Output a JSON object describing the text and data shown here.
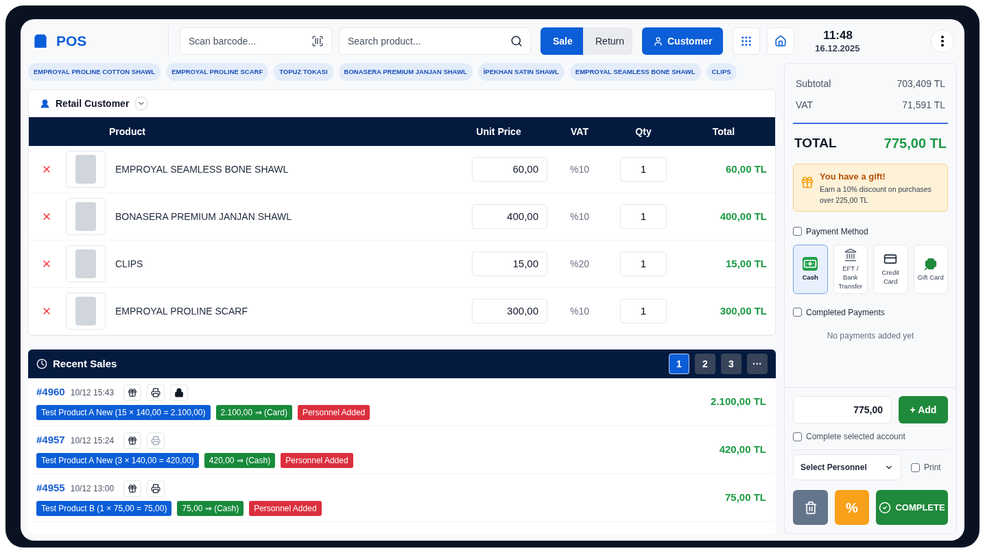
{
  "header": {
    "logo": "POS",
    "barcode": {
      "placeholder": "Scan barcode..."
    },
    "search": {
      "placeholder": "Search product..."
    },
    "modes": [
      {
        "label": "Sale",
        "selected": true
      },
      {
        "label": "Return",
        "selected": false
      }
    ],
    "customer_button": "Customer",
    "time": "11:48",
    "date": "16.12.2025"
  },
  "quick_products": [
    "EMPROYAL PROLINE COTTON SHAWL",
    "EMPROYAL PROLINE SCARF",
    "TOPUZ TOKASI",
    "BONASERA PREMIUM JANJAN SHAWL",
    "İPEKHAN SATIN SHAWL",
    "EMPROYAL SEAMLESS BONE SHAWL",
    "CLIPS"
  ],
  "customer": "Retail Customer",
  "cart": {
    "columns": [
      "Product",
      "Unit Price",
      "VAT",
      "Qty",
      "Total"
    ],
    "rows": [
      {
        "name": "EMPROYAL SEAMLESS BONE SHAWL",
        "price": "60,00",
        "vat": "%10",
        "qty": "1",
        "total": "60,00 TL"
      },
      {
        "name": "BONASERA PREMIUM JANJAN SHAWL",
        "price": "400,00",
        "vat": "%10",
        "qty": "1",
        "total": "400,00 TL"
      },
      {
        "name": "CLIPS",
        "price": "15,00",
        "vat": "%20",
        "qty": "1",
        "total": "15,00 TL"
      },
      {
        "name": "EMPROYAL PROLINE SCARF",
        "price": "300,00",
        "vat": "%10",
        "qty": "1",
        "total": "300,00 TL"
      }
    ]
  },
  "recent_sales": {
    "title": "Recent Sales",
    "pages": [
      {
        "label": "1",
        "selected": true
      },
      {
        "label": "2",
        "selected": false
      },
      {
        "label": "3",
        "selected": false
      },
      {
        "label": "···",
        "selected": false
      }
    ],
    "rows": [
      {
        "id": "#4960",
        "time": "10/12 15:43",
        "actions": [
          {
            "kind": "gift",
            "disabled": false
          },
          {
            "kind": "print",
            "disabled": false
          },
          {
            "kind": "lock",
            "disabled": false
          }
        ],
        "tags": [
          {
            "text": "Test Product A New (15 × 140,00 = 2.100,00)",
            "color": "#0b5ed7"
          },
          {
            "text": "2.100,00 ⇒ (Card)",
            "color": "#198a3c"
          },
          {
            "text": "Personnel Added",
            "color": "#dc2f3d"
          }
        ],
        "total": "2.100,00 TL"
      },
      {
        "id": "#4957",
        "time": "10/12 15:24",
        "actions": [
          {
            "kind": "gift",
            "disabled": false
          },
          {
            "kind": "print",
            "disabled": true
          }
        ],
        "tags": [
          {
            "text": "Test Product A New (3 × 140,00 = 420,00)",
            "color": "#0b5ed7"
          },
          {
            "text": "420,00 ⇒ (Cash)",
            "color": "#198a3c"
          },
          {
            "text": "Personnel Added",
            "color": "#dc2f3d"
          }
        ],
        "total": "420,00 TL"
      },
      {
        "id": "#4955",
        "time": "10/12 13:00",
        "actions": [
          {
            "kind": "gift",
            "disabled": false
          },
          {
            "kind": "print",
            "disabled": false
          }
        ],
        "tags": [
          {
            "text": "Test Product B (1 × 75,00 = 75,00)",
            "color": "#0b5ed7"
          },
          {
            "text": "75,00 ⇒ (Cash)",
            "color": "#198a3c"
          },
          {
            "text": "Personnel Added",
            "color": "#dc2f3d"
          }
        ],
        "total": "75,00 TL"
      }
    ]
  },
  "summary": {
    "subtotal_label": "Subtotal",
    "subtotal": "703,409 TL",
    "vat_label": "VAT",
    "vat": "71,591 TL",
    "total_label": "TOTAL",
    "total": "775,00 TL"
  },
  "gift": {
    "title": "You have a gift!",
    "text": "Earn a 10% discount on purchases over 225,00 TL"
  },
  "payment": {
    "label": "Payment Method",
    "checked": false,
    "methods": [
      {
        "kind": "cash",
        "label": "Cash",
        "selected": true
      },
      {
        "kind": "bank",
        "label": "EFT / Bank Transfer",
        "selected": false
      },
      {
        "kind": "card",
        "label": "Credit Card",
        "selected": false
      },
      {
        "kind": "gift",
        "label": "Gift Card",
        "selected": false
      }
    ]
  },
  "completed": {
    "label": "Completed Payments",
    "checked": false,
    "empty": "No payments added yet"
  },
  "amount": "775,00",
  "add_button": "+ Add",
  "complete_account": {
    "label": "Complete selected account",
    "checked": false
  },
  "personnel": "Select Personnel",
  "print": {
    "label": "Print",
    "checked": false
  },
  "discount_button": "%",
  "complete_button": "COMPLETE"
}
